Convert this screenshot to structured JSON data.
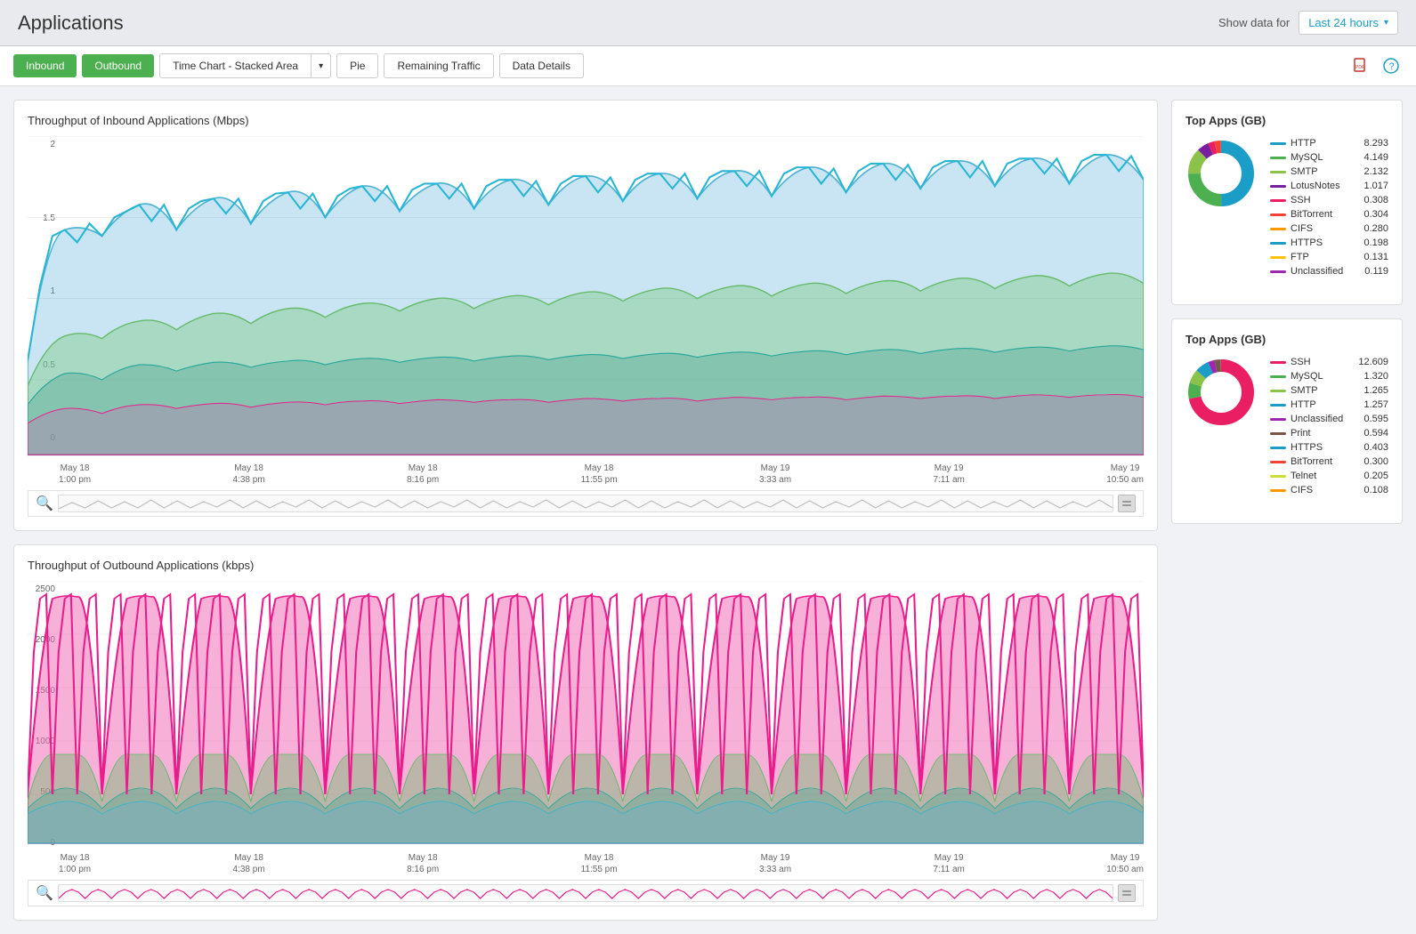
{
  "header": {
    "title": "Applications",
    "show_data_label": "Show data for",
    "time_range": "Last 24 hours"
  },
  "toolbar": {
    "inbound_label": "Inbound",
    "outbound_label": "Outbound",
    "chart_type_label": "Time Chart - Stacked Area",
    "pie_label": "Pie",
    "remaining_label": "Remaining Traffic",
    "data_details_label": "Data Details"
  },
  "inbound": {
    "chart_title": "Throughput of Inbound Applications (Mbps)",
    "y_axis": [
      "2",
      "1.5",
      "1",
      "0.5",
      "0"
    ],
    "x_axis": [
      {
        "line1": "May 18",
        "line2": "1:00 pm"
      },
      {
        "line1": "May 18",
        "line2": "4:38 pm"
      },
      {
        "line1": "May 18",
        "line2": "8:16 pm"
      },
      {
        "line1": "May 18",
        "line2": "11:55 pm"
      },
      {
        "line1": "May 19",
        "line2": "3:33 am"
      },
      {
        "line1": "May 19",
        "line2": "7:11 am"
      },
      {
        "line1": "May 19",
        "line2": "10:50 am"
      }
    ],
    "legend_title": "Top Apps (GB)",
    "apps": [
      {
        "name": "HTTP",
        "value": "8.293",
        "color": "#1a9dc7"
      },
      {
        "name": "MySQL",
        "value": "4.149",
        "color": "#4caf50"
      },
      {
        "name": "SMTP",
        "value": "2.132",
        "color": "#8bc34a"
      },
      {
        "name": "LotusNotes",
        "value": "1.017",
        "color": "#7b1fa2"
      },
      {
        "name": "SSH",
        "value": "0.308",
        "color": "#e91e63"
      },
      {
        "name": "BitTorrent",
        "value": "0.304",
        "color": "#f44336"
      },
      {
        "name": "CIFS",
        "value": "0.280",
        "color": "#ff9800"
      },
      {
        "name": "HTTPS",
        "value": "0.198",
        "color": "#1a9dc7"
      },
      {
        "name": "FTP",
        "value": "0.131",
        "color": "#ffc107"
      },
      {
        "name": "Unclassified",
        "value": "0.119",
        "color": "#9c27b0"
      }
    ],
    "donut": {
      "segments": [
        {
          "color": "#1a9dc7",
          "pct": 50
        },
        {
          "color": "#4caf50",
          "pct": 25
        },
        {
          "color": "#8bc34a",
          "pct": 13
        },
        {
          "color": "#7b1fa2",
          "pct": 6
        },
        {
          "color": "#e91e63",
          "pct": 3
        },
        {
          "color": "#f44336",
          "pct": 3
        }
      ]
    }
  },
  "outbound": {
    "chart_title": "Throughput of Outbound Applications (kbps)",
    "y_axis": [
      "2500",
      "2000",
      "1500",
      "1000",
      "500",
      "0"
    ],
    "x_axis": [
      {
        "line1": "May 18",
        "line2": "1:00 pm"
      },
      {
        "line1": "May 18",
        "line2": "4:38 pm"
      },
      {
        "line1": "May 18",
        "line2": "8:16 pm"
      },
      {
        "line1": "May 18",
        "line2": "11:55 pm"
      },
      {
        "line1": "May 19",
        "line2": "3:33 am"
      },
      {
        "line1": "May 19",
        "line2": "7:11 am"
      },
      {
        "line1": "May 19",
        "line2": "10:50 am"
      }
    ],
    "legend_title": "Top Apps (GB)",
    "apps": [
      {
        "name": "SSH",
        "value": "12.609",
        "color": "#e91e63"
      },
      {
        "name": "MySQL",
        "value": "1.320",
        "color": "#4caf50"
      },
      {
        "name": "SMTP",
        "value": "1.265",
        "color": "#8bc34a"
      },
      {
        "name": "HTTP",
        "value": "1.257",
        "color": "#1a9dc7"
      },
      {
        "name": "Unclassified",
        "value": "0.595",
        "color": "#9c27b0"
      },
      {
        "name": "Print",
        "value": "0.594",
        "color": "#795548"
      },
      {
        "name": "HTTPS",
        "value": "0.403",
        "color": "#1a9dc7"
      },
      {
        "name": "BitTorrent",
        "value": "0.300",
        "color": "#f44336"
      },
      {
        "name": "Telnet",
        "value": "0.205",
        "color": "#cddc39"
      },
      {
        "name": "CIFS",
        "value": "0.108",
        "color": "#ff9800"
      }
    ],
    "donut": {
      "segments": [
        {
          "color": "#e91e63",
          "pct": 72
        },
        {
          "color": "#4caf50",
          "pct": 8
        },
        {
          "color": "#8bc34a",
          "pct": 7
        },
        {
          "color": "#1a9dc7",
          "pct": 7
        },
        {
          "color": "#9c27b0",
          "pct": 3
        },
        {
          "color": "#795548",
          "pct": 3
        }
      ]
    }
  }
}
